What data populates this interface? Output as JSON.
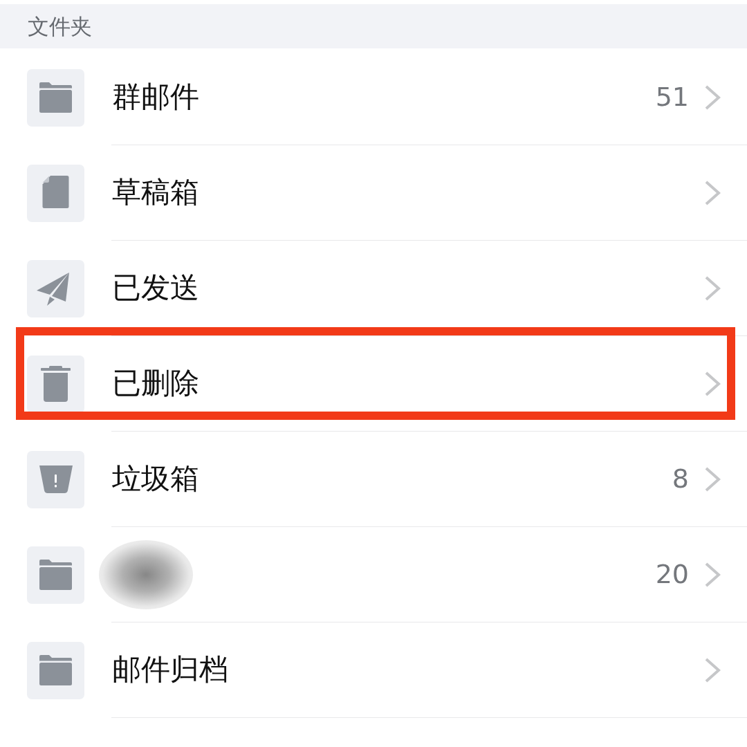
{
  "header": {
    "title": "文件夹"
  },
  "folders": [
    {
      "kind": "folder",
      "name": "群邮件",
      "count": "51",
      "redacted": false,
      "highlighted": false
    },
    {
      "kind": "draft",
      "name": "草稿箱",
      "redacted": false,
      "highlighted": false
    },
    {
      "kind": "sent",
      "name": "已发送",
      "redacted": false,
      "highlighted": false
    },
    {
      "kind": "trash",
      "name": "已删除",
      "redacted": false,
      "highlighted": true
    },
    {
      "kind": "spam",
      "name": "垃圾箱",
      "count": "8",
      "redacted": false,
      "highlighted": false
    },
    {
      "kind": "folder",
      "count": "20",
      "redacted": true,
      "highlighted": false
    },
    {
      "kind": "folder",
      "name": "邮件归档",
      "redacted": false,
      "highlighted": false
    }
  ]
}
